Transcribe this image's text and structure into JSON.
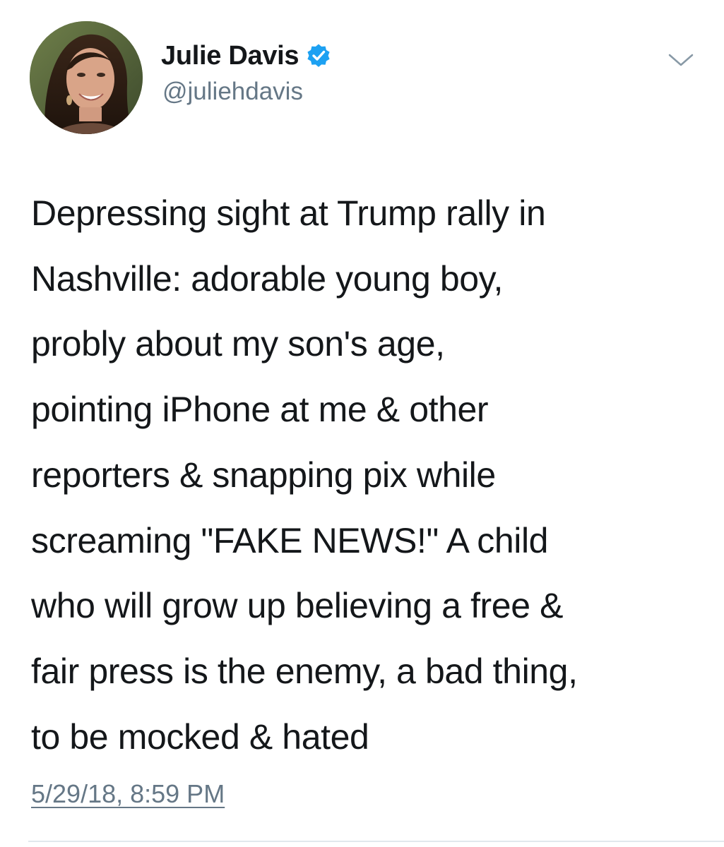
{
  "tweet": {
    "author": {
      "display_name": "Julie Davis",
      "handle": "@juliehdavis",
      "verified": true,
      "avatar_icon": "profile-photo",
      "verified_icon": "verified-badge-icon",
      "verified_color": "#1da1f2"
    },
    "menu_icon": "chevron-down-icon",
    "text_lines": [
      "Depressing sight at Trump rally in",
      "Nashville: adorable young boy,",
      "probly about my son's age,",
      "pointing iPhone at me & other",
      "reporters & snapping pix while",
      "screaming \"FAKE NEWS!\" A child",
      "who will grow up believing a free &",
      "fair press is the enemy, a bad thing,",
      "to be mocked & hated"
    ],
    "timestamp": "5/29/18, 8:59 PM",
    "colors": {
      "primary_text": "#14171a",
      "secondary_text": "#657786",
      "divider": "#e1e8ed"
    }
  }
}
